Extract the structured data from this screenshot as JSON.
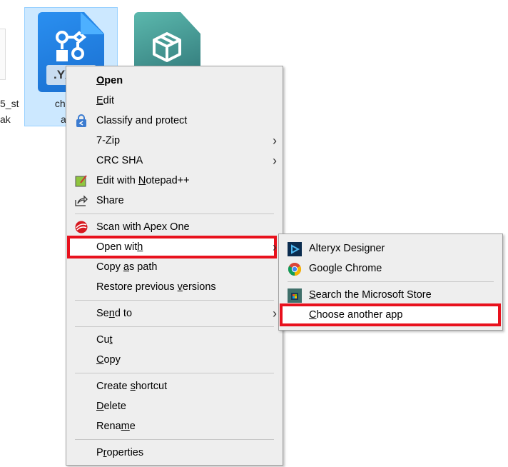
{
  "desktop": {
    "left_file_label": [
      "5_st",
      "ak"
    ],
    "selected_file": {
      "ext": ".YX",
      "label": [
        "challen",
        "art_f"
      ]
    }
  },
  "context_menu": {
    "items": [
      {
        "pre": "",
        "key": "O",
        "post": "pen",
        "bold": true,
        "icon": ""
      },
      {
        "pre": "",
        "key": "E",
        "post": "dit",
        "icon": ""
      },
      {
        "pre": "Classify and protect",
        "key": "",
        "post": "",
        "icon": "lock-icon"
      },
      {
        "pre": "7-Zip",
        "key": "",
        "post": "",
        "icon": "",
        "submenu": true
      },
      {
        "pre": "CRC SHA",
        "key": "",
        "post": "",
        "icon": "",
        "submenu": true
      },
      {
        "pre": "Edit with ",
        "key": "N",
        "post": "otepad++",
        "icon": "notepad-icon"
      },
      {
        "pre": "Share",
        "key": "",
        "post": "",
        "icon": "share-icon"
      },
      {
        "sep": true
      },
      {
        "pre": "Scan with Apex One",
        "key": "",
        "post": "",
        "icon": "apex-one-icon"
      },
      {
        "pre": "Open wit",
        "key": "h",
        "post": "",
        "icon": "",
        "submenu": true,
        "highlighted": true
      },
      {
        "pre": "Copy ",
        "key": "a",
        "post": "s path",
        "icon": ""
      },
      {
        "pre": "Restore previous ",
        "key": "v",
        "post": "ersions",
        "icon": ""
      },
      {
        "sep": true
      },
      {
        "pre": "Se",
        "key": "n",
        "post": "d to",
        "icon": "",
        "submenu": true
      },
      {
        "sep": true
      },
      {
        "pre": "Cu",
        "key": "t",
        "post": "",
        "icon": ""
      },
      {
        "pre": "",
        "key": "C",
        "post": "opy",
        "icon": ""
      },
      {
        "sep": true
      },
      {
        "pre": "Create ",
        "key": "s",
        "post": "hortcut",
        "icon": ""
      },
      {
        "pre": "",
        "key": "D",
        "post": "elete",
        "icon": ""
      },
      {
        "pre": "Rena",
        "key": "m",
        "post": "e",
        "icon": ""
      },
      {
        "sep": true
      },
      {
        "pre": "P",
        "key": "r",
        "post": "operties",
        "icon": ""
      }
    ]
  },
  "open_with_submenu": {
    "items": [
      {
        "pre": "Alteryx Designer",
        "key": "",
        "post": "",
        "icon": "alteryx-icon"
      },
      {
        "pre": "Google Chrome",
        "key": "",
        "post": "",
        "icon": "chrome-icon"
      },
      {
        "sep": true
      },
      {
        "pre": "",
        "key": "S",
        "post": "earch the Microsoft Store",
        "icon": "store-icon"
      },
      {
        "pre": "",
        "key": "C",
        "post": "hoose another app",
        "icon": "",
        "highlighted": true
      }
    ]
  },
  "colors": {
    "highlight": "#e8111d",
    "menu_bg": "#eeeeee",
    "selection": "#cce8ff"
  }
}
